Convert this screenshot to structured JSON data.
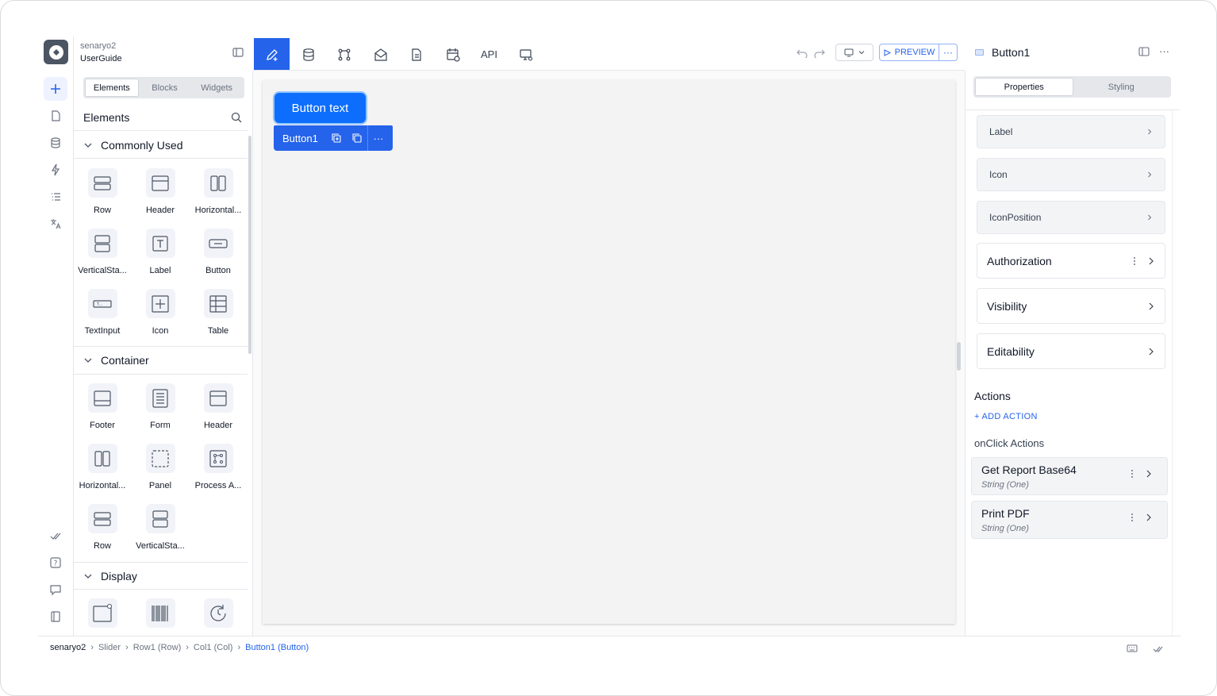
{
  "project": {
    "name": "senaryo2",
    "app": "UserGuide"
  },
  "left_tabs": [
    "Elements",
    "Blocks",
    "Widgets"
  ],
  "elements_header": "Elements",
  "sections": {
    "commonly_used": {
      "title": "Commonly Used",
      "items": [
        "Row",
        "Header",
        "Horizontal...",
        "VerticalSta...",
        "Label",
        "Button",
        "TextInput",
        "Icon",
        "Table"
      ]
    },
    "container": {
      "title": "Container",
      "items": [
        "Footer",
        "Form",
        "Header",
        "Horizontal...",
        "Panel",
        "Process A...",
        "Row",
        "VerticalSta..."
      ]
    },
    "display": {
      "title": "Display"
    }
  },
  "toolbar": {
    "api_label": "API",
    "preview_label": "PREVIEW",
    "more_label": "···"
  },
  "canvas": {
    "button_text": "Button text",
    "selected_name": "Button1",
    "more": "···"
  },
  "right_panel": {
    "title": "Button1",
    "tabs": [
      "Properties",
      "Styling"
    ],
    "props": [
      "Label",
      "Icon",
      "IconPosition"
    ],
    "groups": [
      "Authorization",
      "Visibility",
      "Editability"
    ],
    "actions_title": "Actions",
    "add_action": "+ ADD ACTION",
    "onclick_title": "onClick Actions",
    "onclick_actions": [
      {
        "name": "Get Report Base64",
        "type": "String (One)"
      },
      {
        "name": "Print PDF",
        "type": "String (One)"
      }
    ]
  },
  "breadcrumb": [
    "senaryo2",
    "Slider",
    "Row1 (Row)",
    "Col1 (Col)",
    "Button1 (Button)"
  ],
  "colors": {
    "accent": "#2563eb",
    "button": "#0d6efd"
  }
}
